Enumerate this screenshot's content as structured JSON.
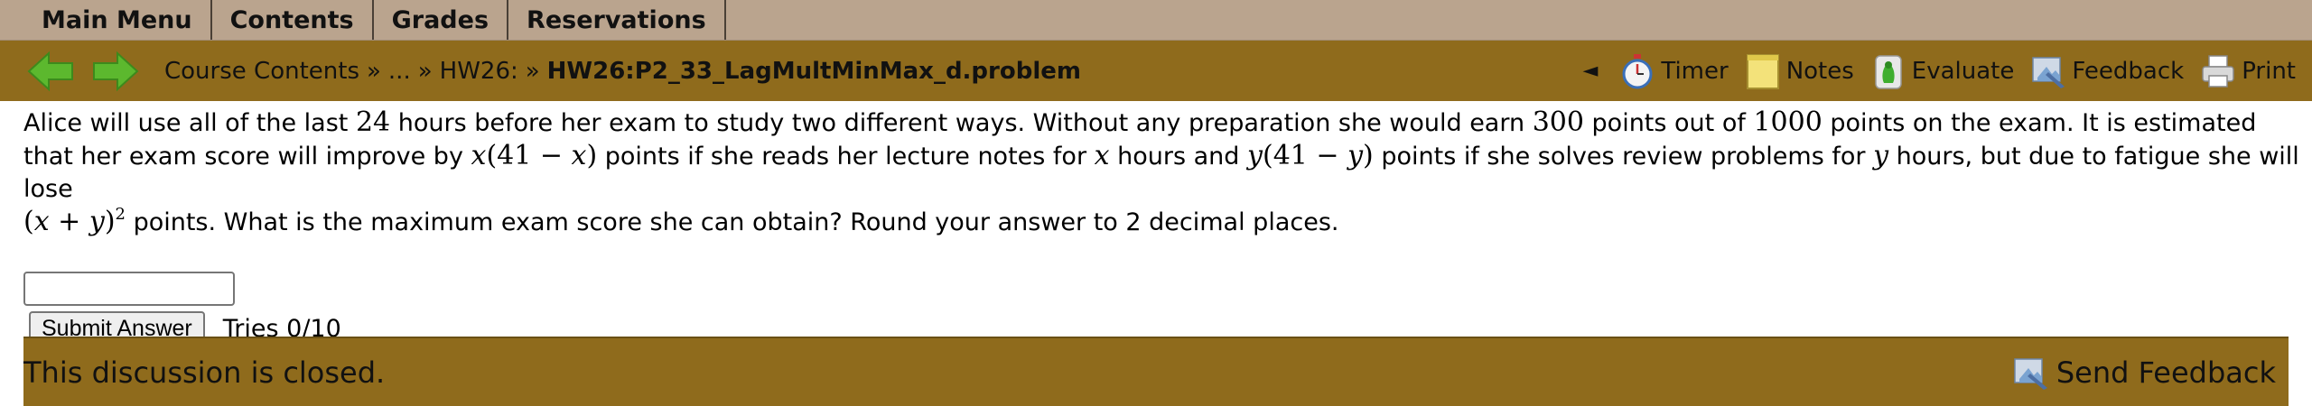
{
  "menu": {
    "tabs": [
      "Main Menu",
      "Contents",
      "Grades",
      "Reservations"
    ]
  },
  "nav": {
    "breadcrumb": {
      "course_contents": "Course Contents",
      "sep1": "»",
      "ellipsis": "...",
      "sep2": "»",
      "hw": "HW26:",
      "sep3": "»",
      "current": "HW26:P2_33_LagMultMinMax_d.problem"
    },
    "collapse": "◄",
    "tools": {
      "timer": "Timer",
      "notes": "Notes",
      "evaluate": "Evaluate",
      "feedback": "Feedback",
      "print": "Print"
    }
  },
  "problem": {
    "p1": "Alice will use all of the last ",
    "hours_val": "24",
    "p2": " hours before her exam to study two different ways. Without any preparation she would earn ",
    "points_val": "300",
    "p3": " points out of ",
    "total_val": "1000",
    "p4": " points on the exam. It is estimated that her exam score will improve by ",
    "expr1_a": "x",
    "expr1_b": "(41 − ",
    "expr1_c": "x",
    "expr1_d": ")",
    "p5": " points if she reads her lecture notes for ",
    "var_x": "x",
    "p6": " hours and ",
    "expr2_a": "y",
    "expr2_b": "(41 − ",
    "expr2_c": "y",
    "expr2_d": ")",
    "p7": " points if she solves review problems for ",
    "var_y": "y",
    "p8": " hours, but due to fatigue she will lose",
    "expr3_a": "(",
    "expr3_b": "x",
    "expr3_c": " + ",
    "expr3_d": "y",
    "expr3_e": ")",
    "expr3_sup": "2",
    "p9": " points. What is the maximum exam score she can obtain? Round your answer to 2 decimal places."
  },
  "answer": {
    "value": "",
    "submit_label": "Submit Answer",
    "tries": "Tries 0/10"
  },
  "discussion": {
    "text": "This discussion is closed.",
    "send_feedback": "Send Feedback"
  },
  "colors": {
    "menu_bg": "#baa48e",
    "nav_bg": "#8f6b1c",
    "arrow_green": "#5cb82e"
  }
}
